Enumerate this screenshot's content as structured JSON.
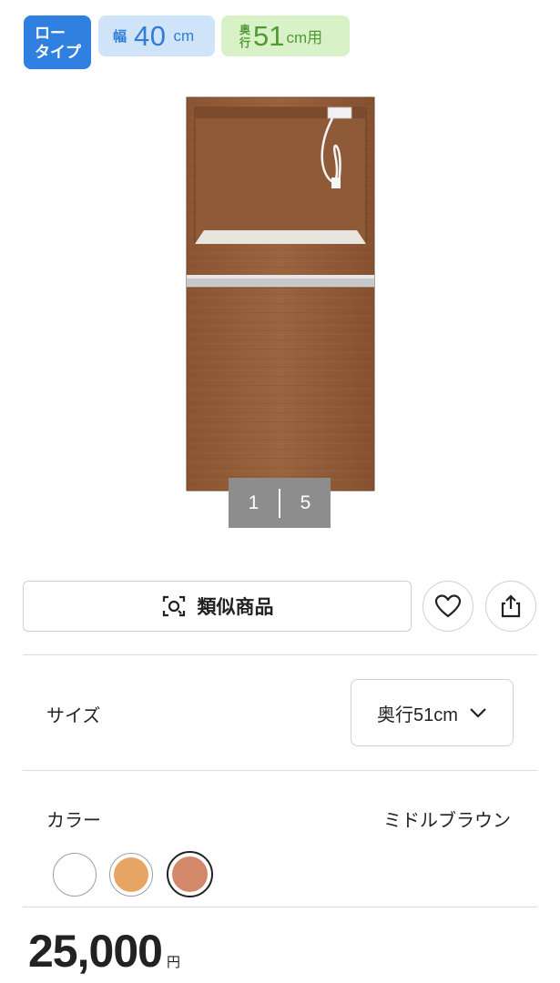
{
  "badges": {
    "type": {
      "line1": "ロー",
      "line2": "タイプ",
      "color": "#2f80e0"
    },
    "width": {
      "prefix": "幅",
      "value": "40",
      "unit": "cm",
      "bg": "#cfe4f8"
    },
    "depth": {
      "prefix_top": "奥",
      "prefix_bottom": "行",
      "value": "51",
      "unit": "cm用",
      "bg": "#d9f1c7"
    }
  },
  "gallery": {
    "current": "1",
    "total": "5"
  },
  "actions": {
    "similar_label": "類似商品",
    "similar_icon": "camera-search-icon",
    "favorite_icon": "heart-icon",
    "share_icon": "share-icon"
  },
  "size": {
    "label": "サイズ",
    "selected": "奥行51cm"
  },
  "color": {
    "label": "カラー",
    "selected": "ミドルブラウン",
    "swatches": [
      {
        "name": "white",
        "hex": "#ffffff"
      },
      {
        "name": "orange",
        "hex": "#e8a462"
      },
      {
        "name": "brown",
        "hex": "#d4886a",
        "selected": true
      }
    ]
  },
  "price": {
    "amount": "25,000",
    "currency": "円"
  }
}
